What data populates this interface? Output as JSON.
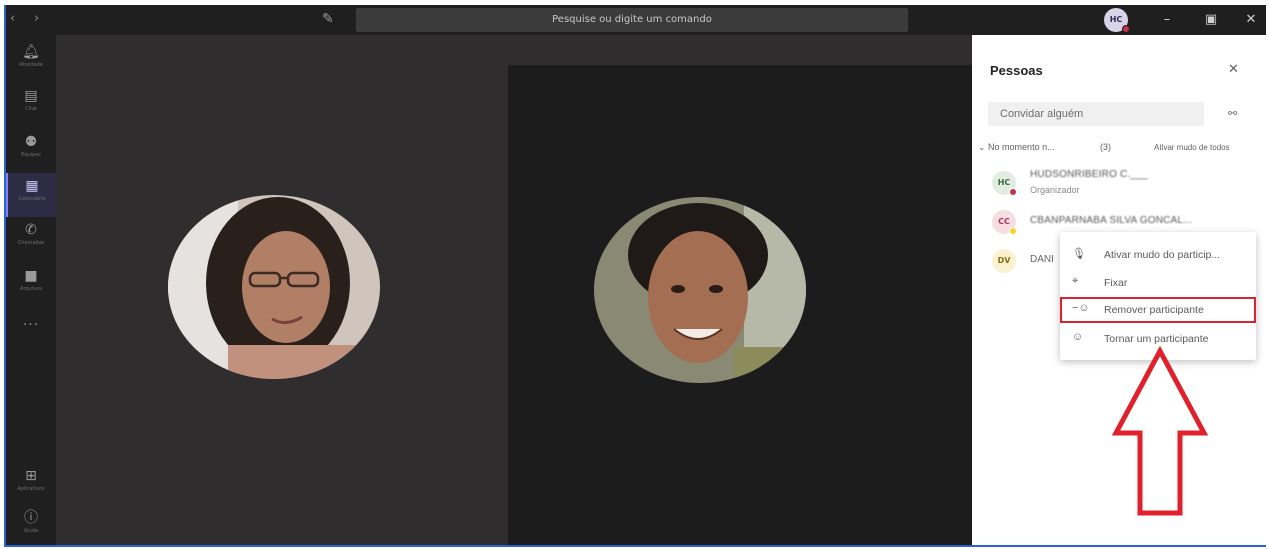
{
  "titlebar": {
    "back_icon": "chevron-left-icon",
    "forward_icon": "chevron-right-icon",
    "compose_icon": "compose-icon",
    "search_placeholder": "Pesquise ou digite um comando",
    "me_initials": "HC",
    "presence_color": "#c4314b"
  },
  "rail": {
    "items": [
      {
        "label": "Atividade",
        "icon": "bell-icon"
      },
      {
        "label": "Chat",
        "icon": "chat-icon"
      },
      {
        "label": "Equipes",
        "icon": "teams-icon"
      },
      {
        "label": "Calendário",
        "icon": "calendar-icon",
        "active": true
      },
      {
        "label": "Chamadas",
        "icon": "phone-icon"
      },
      {
        "label": "Arquivos",
        "icon": "files-icon"
      }
    ],
    "more": "···",
    "bottom": [
      {
        "label": "Aplicativos",
        "icon": "apps-icon"
      },
      {
        "label": "Ajuda",
        "icon": "help-icon"
      }
    ]
  },
  "people_panel": {
    "title": "Pessoas",
    "invite_placeholder": "Convidar alguém",
    "section_label": "No momento n...",
    "section_count": "(3)",
    "mute_all": "Ativar mudo de todos",
    "participants": [
      {
        "initials": "HC",
        "name": "HUDSONRIBEIRO C.___",
        "role": "Organizador",
        "avatar_bg": "#e3ece2",
        "avatar_fg": "#3a6b3a",
        "status_color": "#c4314b"
      },
      {
        "initials": "CC",
        "name": "CBANPARNABA SILVA GONCAL...",
        "role": "",
        "avatar_bg": "#f7dce3",
        "avatar_fg": "#a13a59",
        "status_color": "#f8d22a"
      },
      {
        "initials": "DV",
        "name": "DANI",
        "role": "",
        "avatar_bg": "#f9f1d0",
        "avatar_fg": "#8a6d12",
        "status_color": ""
      }
    ]
  },
  "context_menu": {
    "items": [
      {
        "label": "Ativar mudo do particip...",
        "icon": "mic-icon"
      },
      {
        "label": "Fixar",
        "icon": "pin-icon"
      },
      {
        "label": "Remover participante",
        "icon": "remove-person-icon",
        "highlighted": true
      },
      {
        "label": "Tornar um participante",
        "icon": "person-icon"
      }
    ],
    "highlight_color": "#d9232e"
  }
}
